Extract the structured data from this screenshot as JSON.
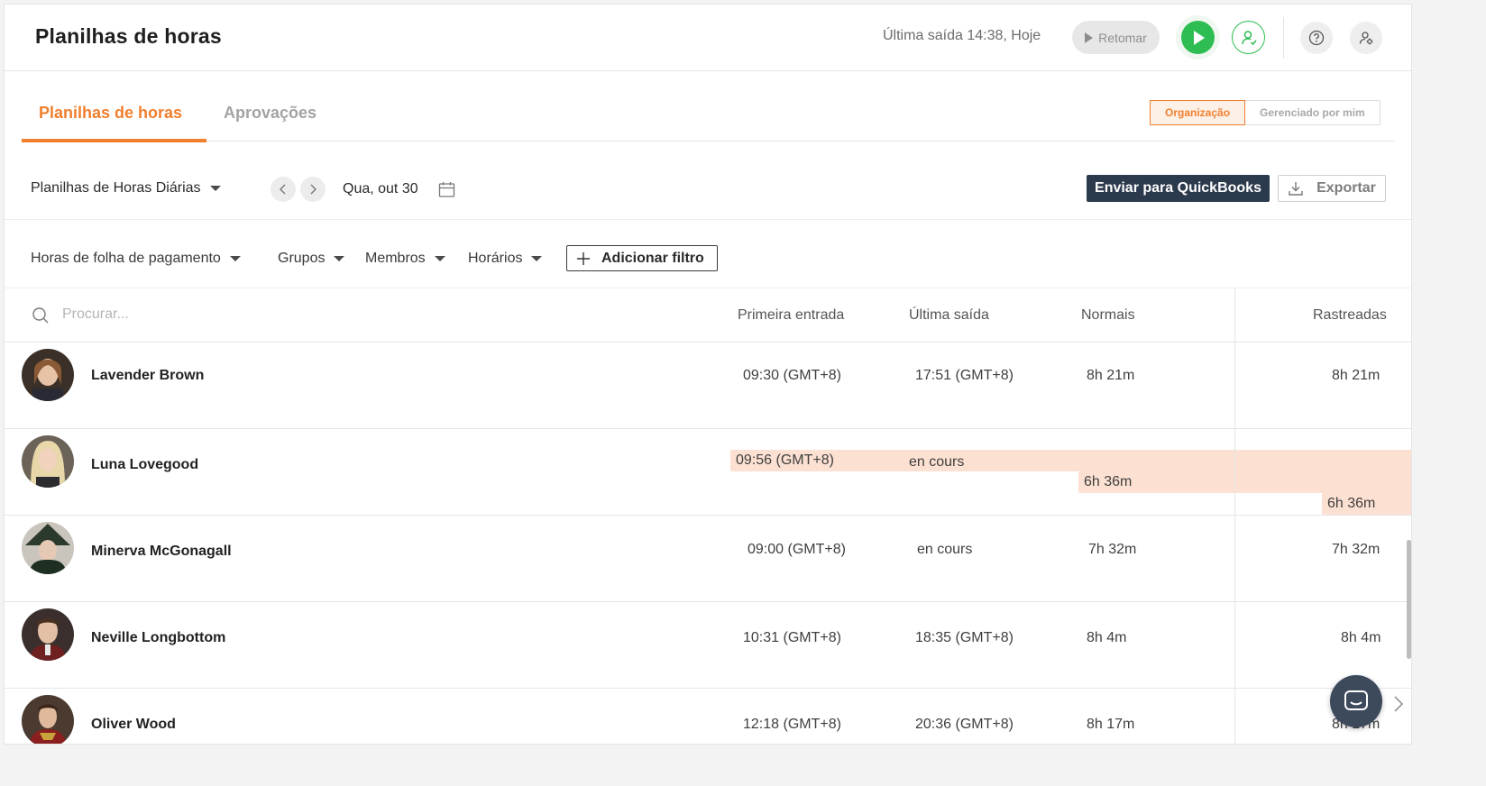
{
  "header": {
    "title": "Planilhas de horas",
    "last_exit": "Última saída 14:38, Hoje",
    "resume_label": "Retomar"
  },
  "tabs": [
    {
      "label": "Planilhas de horas",
      "active": true
    },
    {
      "label": "Aprovações",
      "active": false
    }
  ],
  "scope": {
    "options": [
      "Organização",
      "Gerenciado por mim"
    ],
    "selected": "Organização"
  },
  "toolbar": {
    "period": "Planilhas de Horas Diárias",
    "date": "Qua, out 30",
    "quickbooks_label": "Enviar para QuickBooks",
    "export_label": "Exportar"
  },
  "filters": {
    "items": [
      "Horas de folha de pagamento",
      "Grupos",
      "Membros",
      "Horários"
    ],
    "add_label": "Adicionar filtro"
  },
  "table": {
    "search_placeholder": "Procurar...",
    "columns": [
      "Primeira entrada",
      "Última saída",
      "Normais",
      "Rastreadas"
    ],
    "rows": [
      {
        "name": "Lavender Brown",
        "first_in": "09:30 (GMT+8)",
        "last_out": "17:51 (GMT+8)",
        "regular": "8h 21m",
        "tracked": "8h 21m",
        "flagged": false
      },
      {
        "name": "Luna Lovegood",
        "first_in": "09:56 (GMT+8)",
        "last_out": "en cours",
        "regular": "6h 36m",
        "tracked": "6h 36m",
        "flagged": true
      },
      {
        "name": "Minerva McGonagall",
        "first_in": "09:00 (GMT+8)",
        "last_out": "en cours",
        "regular": "7h 32m",
        "tracked": "7h 32m",
        "flagged": false
      },
      {
        "name": "Neville Longbottom",
        "first_in": "10:31 (GMT+8)",
        "last_out": "18:35 (GMT+8)",
        "regular": "8h 4m",
        "tracked": "8h 4m",
        "flagged": false
      },
      {
        "name": "Oliver Wood",
        "first_in": "12:18 (GMT+8)",
        "last_out": "20:36 (GMT+8)",
        "regular": "8h 17m",
        "tracked": "8h 17m",
        "flagged": false
      }
    ]
  },
  "colors": {
    "accent": "#f07f2e",
    "play_green": "#2dbd52",
    "dark_button": "#2c3a4d",
    "flag_bg": "#fce0d2",
    "flag_dot": "#e84a3b"
  },
  "icons": [
    "play-icon",
    "user-check-icon",
    "help-icon",
    "settings-icon",
    "chevron-left-icon",
    "chevron-right-icon",
    "calendar-icon",
    "download-icon",
    "plus-icon",
    "search-icon",
    "chat-icon"
  ]
}
